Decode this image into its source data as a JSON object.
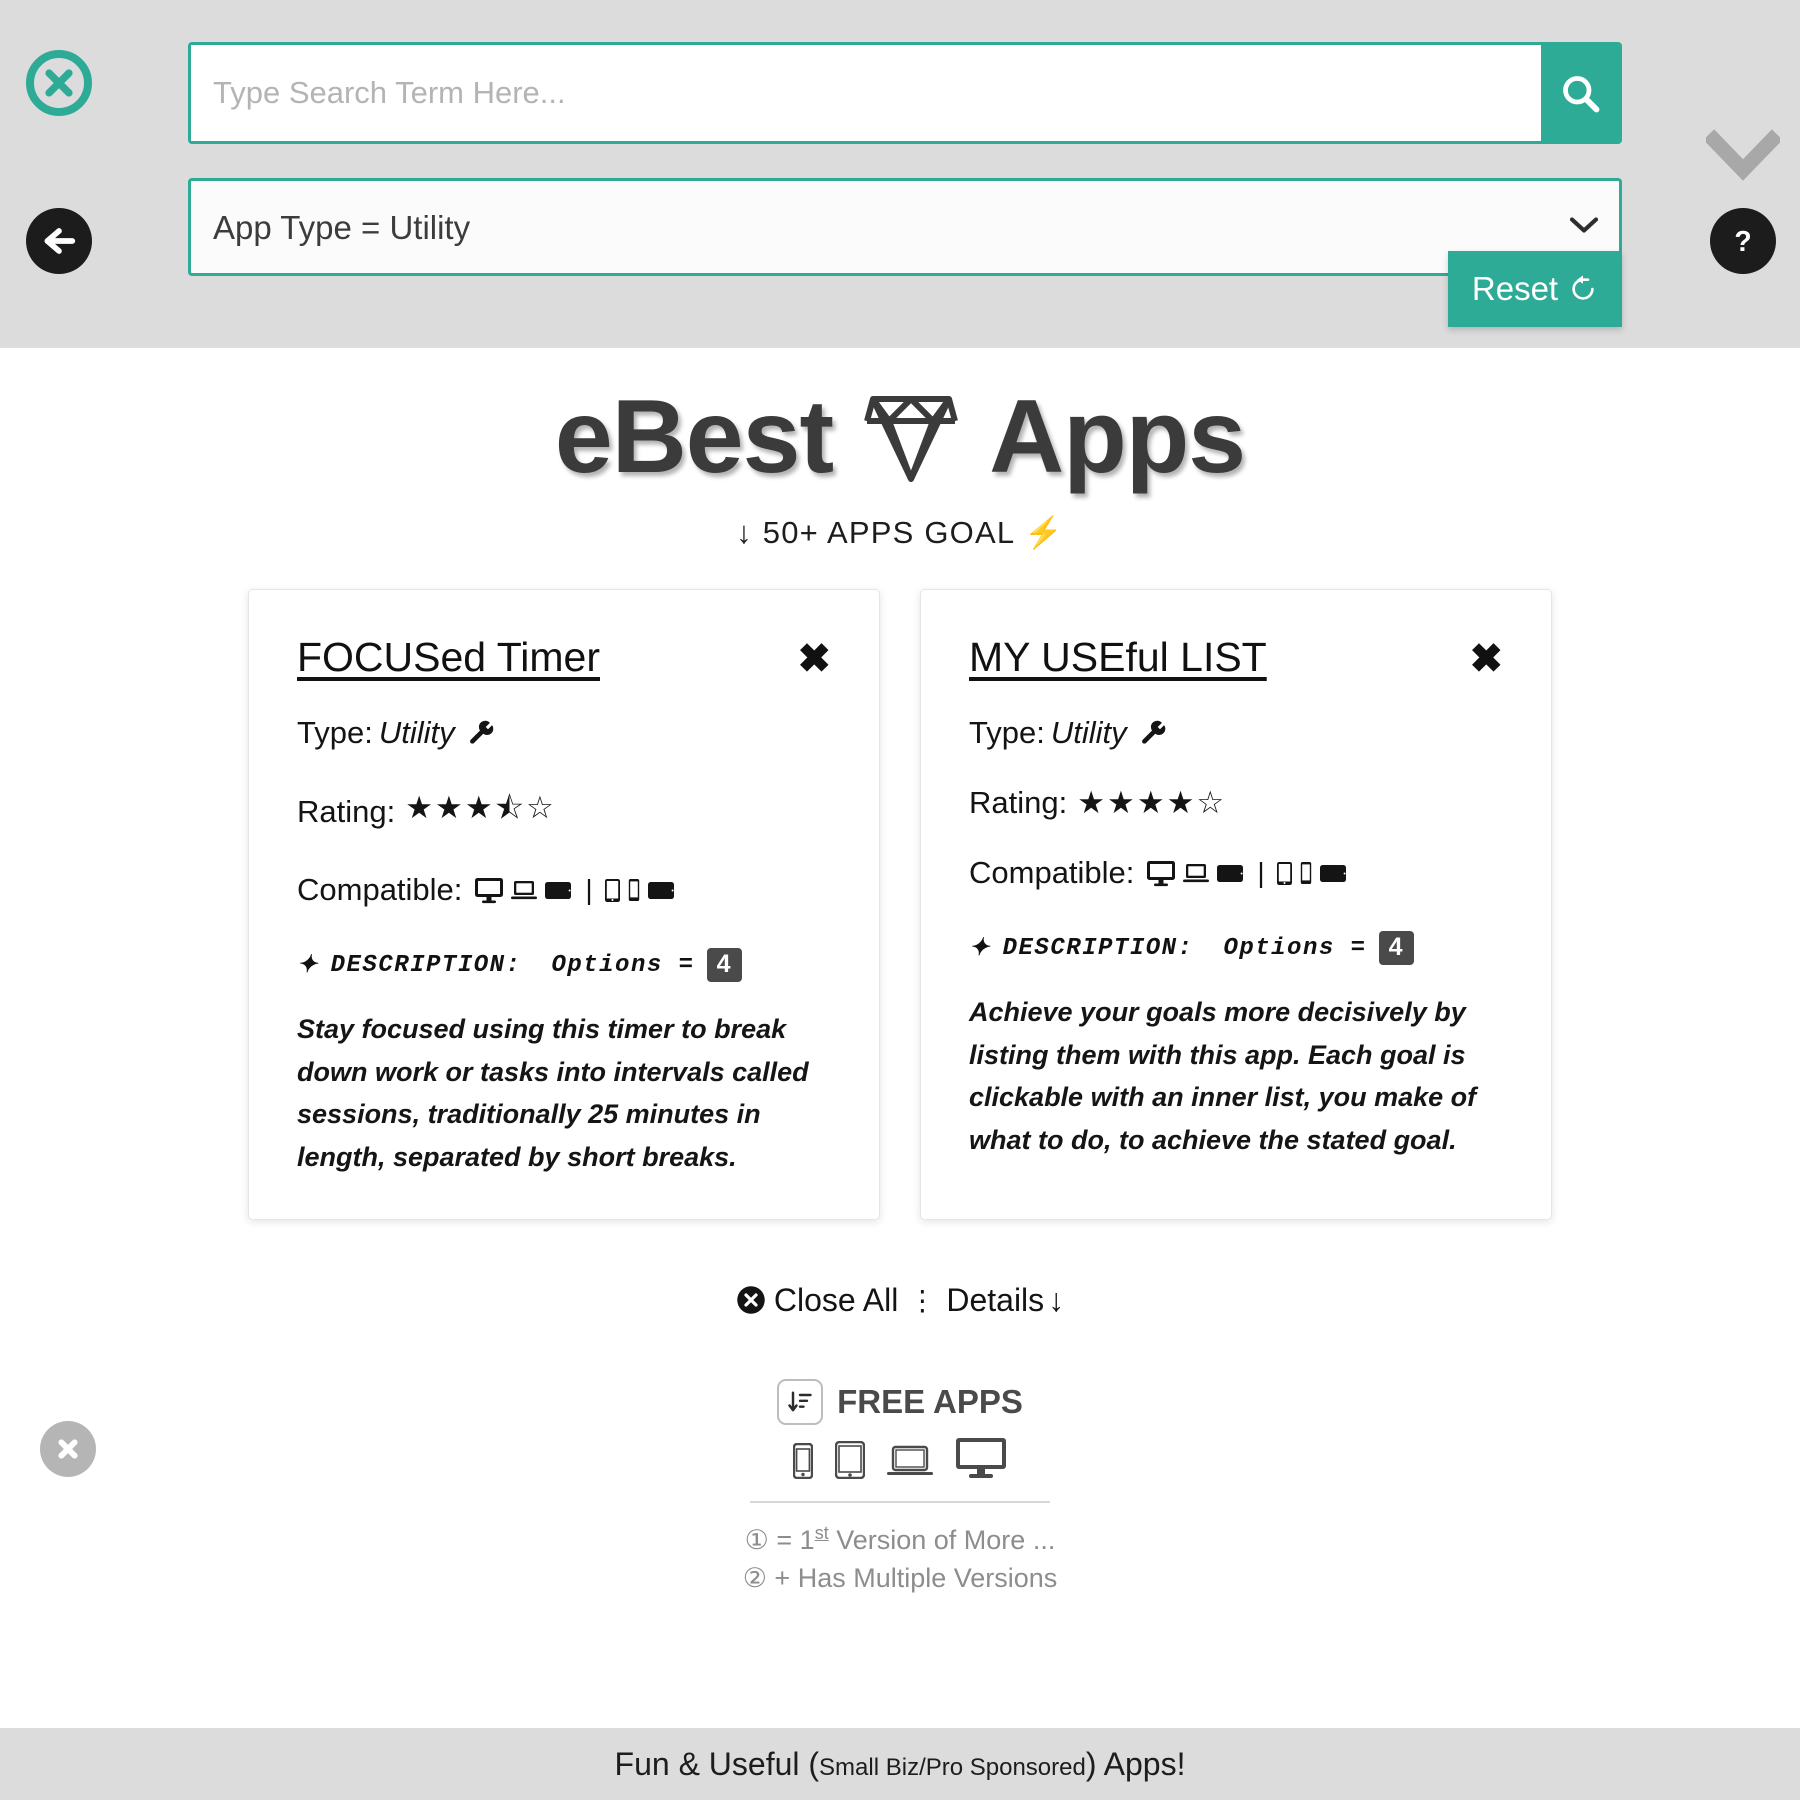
{
  "topbar": {
    "close_icon": "close-circle-icon",
    "back_icon": "back-arrow-icon",
    "help_icon": "question-mark-icon",
    "collapse_icon": "chevron-down-icon",
    "search": {
      "placeholder": "Type Search Term Here...",
      "value": "",
      "button_icon": "search-icon"
    },
    "filter": {
      "selected": "App Type = Utility",
      "options": [
        "App Type = Utility"
      ],
      "chevron_icon": "chevron-down-icon"
    },
    "reset": {
      "label": "Reset",
      "icon": "reset-rotate-icon"
    }
  },
  "brand": {
    "text_before": "eBest",
    "gem_icon": "diamond-icon",
    "text_after": "Apps",
    "goal": "↓ 50+ APPS GOAL ⚡"
  },
  "cards": [
    {
      "title": "FOCUSed Timer",
      "close_icon": "close-x-icon",
      "type_label": "Type:",
      "type_value": "Utility",
      "type_icon": "wrench-icon",
      "rating_label": "Rating:",
      "rating_value": 3.5,
      "rating_max": 5,
      "compatible_label": "Compatible:",
      "compatible_desktop": [
        "desktop-icon",
        "laptop-icon",
        "tablet-landscape-icon"
      ],
      "compatible_mobile": [
        "tablet-portrait-icon",
        "phone-icon",
        "tablet-landscape-icon"
      ],
      "desc_bullet": "✦",
      "desc_label": "DESCRIPTION:",
      "options_label": "Options =",
      "options_count": "4",
      "description": "Stay focused using this timer to break down work or tasks into intervals called sessions, traditionally 25 minutes in length, separated by short breaks."
    },
    {
      "title": "MY USEful LIST",
      "close_icon": "close-x-icon",
      "type_label": "Type:",
      "type_value": "Utility",
      "type_icon": "wrench-icon",
      "rating_label": "Rating:",
      "rating_value": 4,
      "rating_max": 5,
      "compatible_label": "Compatible:",
      "compatible_desktop": [
        "desktop-icon",
        "laptop-icon",
        "tablet-landscape-icon"
      ],
      "compatible_mobile": [
        "tablet-portrait-icon",
        "phone-icon",
        "tablet-landscape-icon"
      ],
      "desc_bullet": "✦",
      "desc_label": "DESCRIPTION:",
      "options_label": "Options =",
      "options_count": "4",
      "description": "Achieve your goals more decisively by listing them with this app. Each goal is clickable with an inner list, you make of what to do, to achieve the stated goal."
    }
  ],
  "actions": {
    "close_all_icon": "close-circle-filled-icon",
    "close_all_label": "Close All",
    "separator": "⋮",
    "details_label": "Details",
    "details_arrow": "↓"
  },
  "free_apps": {
    "sort_icon": "sort-descending-icon",
    "label": "FREE APPS",
    "devices": [
      "phone-icon",
      "tablet-icon",
      "laptop-icon",
      "desktop-icon"
    ]
  },
  "legend": {
    "line1_mark": "①",
    "line1_text_a": "= 1",
    "line1_sup": "st",
    "line1_text_b": "Version of More ...",
    "line2_mark": "②",
    "line2_text": "+ Has Multiple Versions"
  },
  "bottom_close_icon": "close-circle-gray-icon",
  "footer": {
    "part1": "Fun & Useful",
    "paren_open": "(",
    "small": "Small Biz/Pro Sponsored",
    "paren_close": ")",
    "part2": "Apps!"
  },
  "colors": {
    "accent": "#2dab96",
    "bar": "#dcdcdc",
    "dark": "#1c1c1c",
    "badge": "#4a4a4a"
  }
}
